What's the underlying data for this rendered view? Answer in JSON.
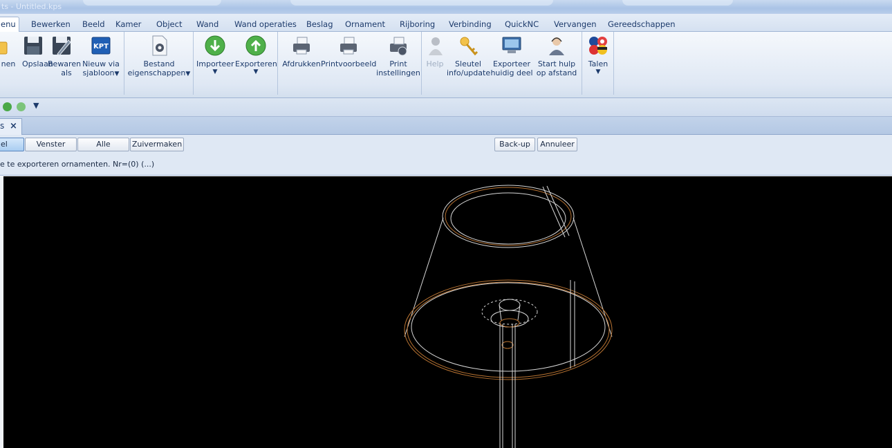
{
  "window": {
    "title": "ts - Untitled.kps"
  },
  "menu_tabs": [
    "enu",
    "Bewerken",
    "Beeld",
    "Kamer",
    "Object",
    "Wand",
    "Wand operaties",
    "Beslag",
    "Ornament",
    "Rijboring",
    "Verbinding",
    "QuickNC",
    "Vervangen",
    "Gereedschappen"
  ],
  "ribbon": {
    "open": [
      "nen",
      ""
    ],
    "save": [
      "Opslaan",
      ""
    ],
    "save_as": [
      "Bewaren",
      "als"
    ],
    "new_template": [
      "Nieuw via",
      "sjabloon"
    ],
    "properties": [
      "Bestand",
      "eigenschappen"
    ],
    "import": [
      "Importeer",
      ""
    ],
    "export": [
      "Exporteren",
      ""
    ],
    "print": [
      "Afdrukken",
      ""
    ],
    "preview": [
      "Printvoorbeeld",
      ""
    ],
    "print_settings": [
      "Print",
      "instellingen"
    ],
    "help": [
      "Help",
      ""
    ],
    "key": [
      "Sleutel",
      "info/update"
    ],
    "export_part": [
      "Exporteer",
      "huidig deel"
    ],
    "remote_help": [
      "Start hulp",
      "op afstand"
    ],
    "languages": [
      "Talen",
      ""
    ],
    "kpt_badge": "KPT",
    "dropdown_glyph": "▼"
  },
  "document_tab": {
    "prefix": "s",
    "close": "×"
  },
  "command_buttons": {
    "deel": "el",
    "venster": "Venster",
    "alle": "Alle",
    "zuivermaken": "Zuivermaken",
    "backup": "Back-up",
    "annuleer": "Annuleer"
  },
  "status_text": "e te exporteren ornamenten. Nr=(0) (...)",
  "colors": {
    "viewport_bg": "#000000",
    "wire_white": "#d8d8d8",
    "wire_orange": "#b87332"
  }
}
